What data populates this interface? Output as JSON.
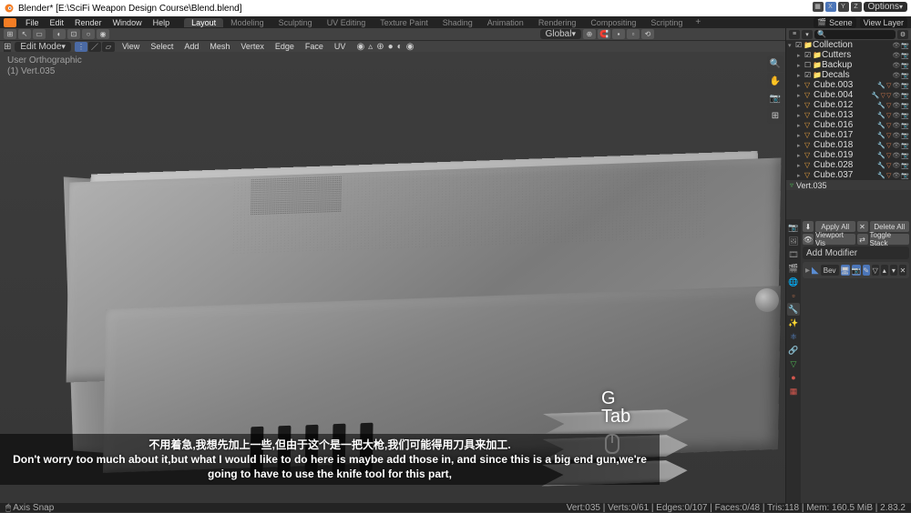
{
  "titlebar": {
    "title": "Blender* [E:\\SciFi Weapon Design Course\\Blend.blend]",
    "minimize": "—",
    "maximize": "☐",
    "close": "✕"
  },
  "topmenu": {
    "items": [
      "File",
      "Edit",
      "Render",
      "Window",
      "Help"
    ],
    "workspaces": [
      "Layout",
      "Modeling",
      "Sculpting",
      "UV Editing",
      "Texture Paint",
      "Shading",
      "Animation",
      "Rendering",
      "Compositing",
      "Scripting"
    ],
    "active_ws": 0,
    "scene_label": "Scene",
    "viewlayer_label": "View Layer"
  },
  "toolheader": {
    "orientation": "Global",
    "options": "Options"
  },
  "editheader": {
    "mode": "Edit Mode",
    "menus": [
      "View",
      "Select",
      "Add",
      "Mesh",
      "Vertex",
      "Edge",
      "Face",
      "UV"
    ]
  },
  "viewport": {
    "overlay1": "User Orthographic",
    "overlay2": "(1) Vert.035",
    "key1": "G",
    "key2": "Tab"
  },
  "subtitle": {
    "line1": "不用着急,我想先加上一些,但由于这个是一把大枪,我们可能得用刀具来加工.",
    "line2": "Don't worry too much about it,but what I would like to do here is maybe add those in, and since this is a big end gun,we're going to have to use the knife tool for this part,"
  },
  "outliner": {
    "search_placeholder": "🔍",
    "collection": "Collection",
    "collections": [
      "Cutters",
      "Backup",
      "Decals"
    ],
    "objects": [
      "Cube.003",
      "Cube.004",
      "Cube.012",
      "Cube.013",
      "Cube.016",
      "Cube.017",
      "Cube.018",
      "Cube.019",
      "Cube.028",
      "Cube.037"
    ],
    "active": "Vert.035"
  },
  "properties": {
    "header": "Vert.035",
    "apply_all": "Apply All",
    "delete_all": "Delete All",
    "viewport_vis": "Viewport Vis",
    "toggle_stack": "Toggle Stack",
    "add_modifier": "Add Modifier",
    "mod_name": "Bev"
  },
  "statusbar": {
    "left": "🖱  Axis Snap",
    "right": "Vert:035 | Verts:0/61 | Edges:0/107 | Faces:0/48 | Tris:118 | Mem: 160.5 MiB | 2.83.2"
  }
}
